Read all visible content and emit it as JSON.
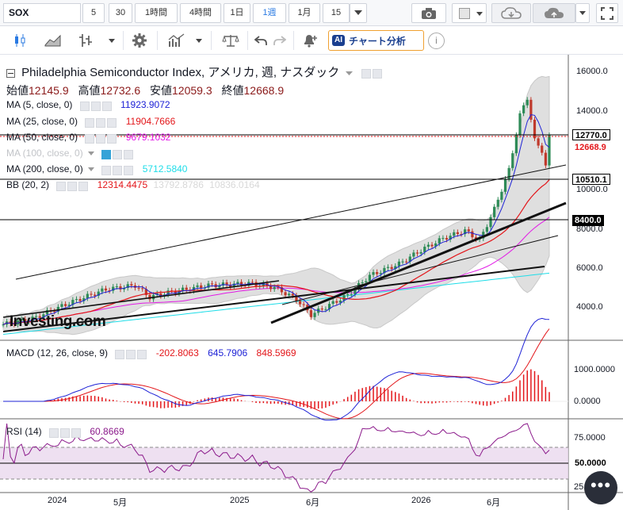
{
  "toolbar": {
    "symbol": "SOX",
    "intervals": [
      "5",
      "30",
      "1時間",
      "4時間",
      "1日",
      "1週",
      "1月",
      "15"
    ],
    "active_interval": "1週",
    "icons": [
      "camera-icon",
      "color-swatch-icon",
      "cloud-download-icon",
      "cloud-upload-icon",
      "fullscreen-icon"
    ]
  },
  "toolbar2": {
    "ai_badge": "AI",
    "ai_label": "チャート分析",
    "info": "i"
  },
  "header": {
    "title": "Philadelphia Semiconductor Index, アメリカ, 週, ナスダック",
    "ohlc": [
      {
        "label": "始値",
        "value": "12145.9"
      },
      {
        "label": "高値",
        "value": "12732.6"
      },
      {
        "label": "安値",
        "value": "12059.3"
      },
      {
        "label": "終値",
        "value": "12668.9"
      }
    ]
  },
  "indicators": [
    {
      "name": "MA (5, close, 0)",
      "value": "11923.9072",
      "color": "#1e22d6"
    },
    {
      "name": "MA (25, close, 0)",
      "value": "11904.7666",
      "color": "#e3161a"
    },
    {
      "name": "MA (50, close, 0)",
      "value": "9679.1032",
      "color": "#e21be6"
    },
    {
      "name": "MA (100, close, 0)",
      "value": "",
      "color": "#bdbdbd"
    },
    {
      "name": "MA (200, close, 0)",
      "value": "5712.5840",
      "color": "#1edde8"
    },
    {
      "name": "BB (20, 2)",
      "value": "12314.4475",
      "extra1": "13792.8786",
      "extra2": "10836.0164",
      "color": "#e3161a"
    }
  ],
  "price_axis": {
    "labels": [
      "16000.0",
      "14000.0",
      "12000.0",
      "10000.0",
      "8000.0",
      "6000.0",
      "4000.0"
    ],
    "tags": [
      {
        "text": "12770.0",
        "bg": "#ffffff",
        "fg": "#000000"
      },
      {
        "text": "12668.9",
        "bg": "#ffffff",
        "fg": "#e3161a"
      },
      {
        "text": "10510.1",
        "bg": "#ffffff",
        "fg": "#000000"
      },
      {
        "text": "8400.0",
        "bg": "#000000",
        "fg": "#ffffff"
      }
    ]
  },
  "macd": {
    "name": "MACD (12, 26, close, 9)",
    "values": [
      "-202.8063",
      "645.7906",
      "848.5969"
    ],
    "colors": [
      "#e3161a",
      "#1e22d6",
      "#e3161a"
    ],
    "axis": [
      "1000.0000",
      "0.0000"
    ]
  },
  "rsi": {
    "name": "RSI (14)",
    "value": "60.8669",
    "axis": [
      "75.0000",
      "50.0000",
      "25.0"
    ]
  },
  "time_axis": [
    "2024",
    "5月",
    "2025",
    "6月",
    "2026",
    "6月"
  ],
  "watermark": "Investing.com",
  "more_button": "•••"
}
